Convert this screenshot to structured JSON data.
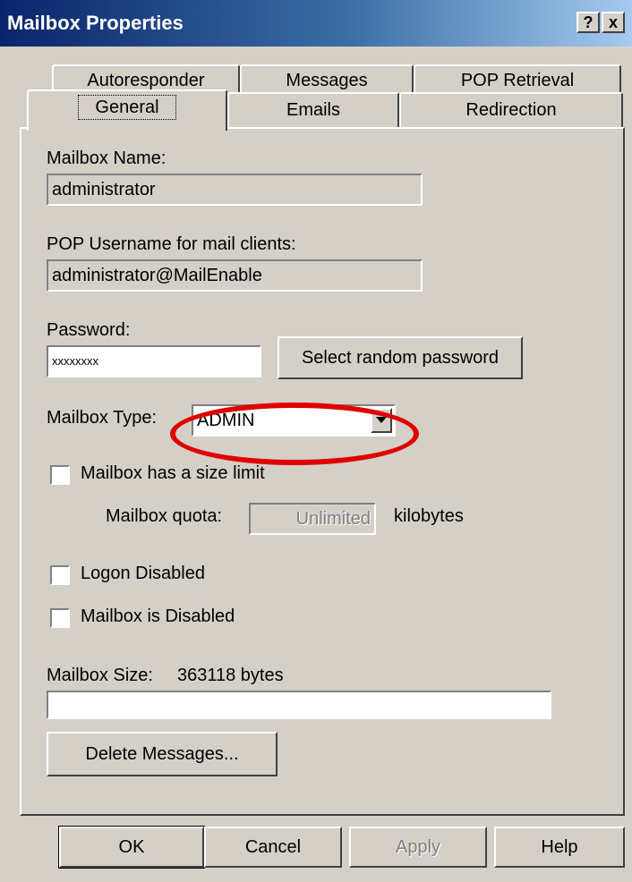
{
  "window": {
    "title": "Mailbox Properties",
    "help_button": "?",
    "close_button": "x"
  },
  "tabs": {
    "row1": [
      "Autoresponder",
      "Messages",
      "POP Retrieval"
    ],
    "row2": [
      "General",
      "Emails",
      "Redirection"
    ],
    "active": "General"
  },
  "general": {
    "mailbox_name_label": "Mailbox Name:",
    "mailbox_name_value": "administrator",
    "pop_username_label": "POP Username for mail clients:",
    "pop_username_value": "administrator@MailEnable",
    "password_label": "Password:",
    "password_value": "xxxxxxxx",
    "random_password_button": "Select random password",
    "mailbox_type_label": "Mailbox Type:",
    "mailbox_type_value": "ADMIN",
    "size_limit_label": "Mailbox has a size limit",
    "size_limit_checked": false,
    "quota_label": "Mailbox quota:",
    "quota_value": "Unlimited",
    "quota_unit": "kilobytes",
    "logon_disabled_label": "Logon Disabled",
    "logon_disabled_checked": false,
    "mailbox_disabled_label": "Mailbox is Disabled",
    "mailbox_disabled_checked": false,
    "mailbox_size_label": "Mailbox Size:",
    "mailbox_size_value": "363118 bytes",
    "mailbox_size_fill": 0,
    "delete_messages_button": "Delete Messages..."
  },
  "footer": {
    "ok": "OK",
    "cancel": "Cancel",
    "apply": "Apply",
    "help": "Help"
  },
  "colors": {
    "highlight": "#e00000",
    "titlebar_start": "#0a246a",
    "titlebar_end": "#a6caf0"
  }
}
